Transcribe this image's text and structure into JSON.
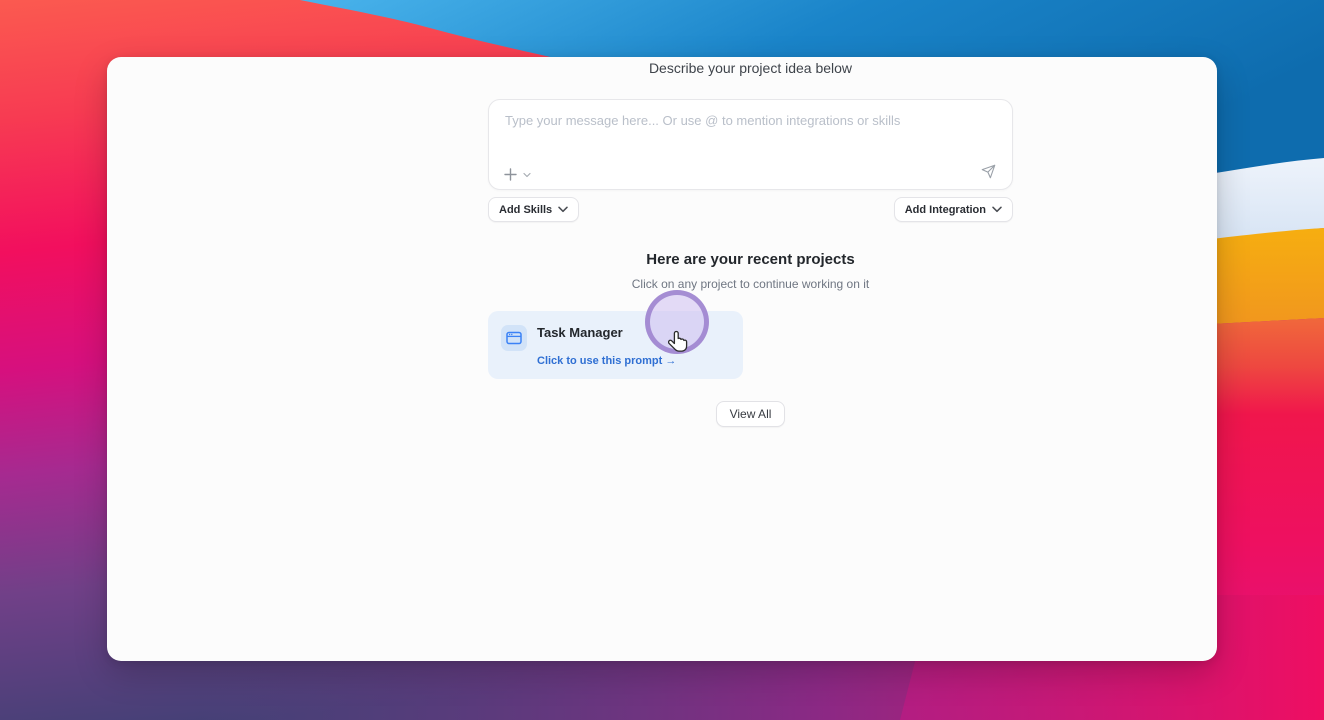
{
  "window": {
    "heading": "Describe your project idea below",
    "composer": {
      "placeholder": "Type your message here... Or use @ to mention integrations or skills",
      "icons": {
        "attach": "plus-icon",
        "attach_expand": "chevron-down-icon",
        "send": "send-icon"
      }
    },
    "actions": {
      "add_skills_label": "Add Skills",
      "add_integration_label": "Add Integration"
    },
    "recent": {
      "title": "Here are your recent projects",
      "subtitle": "Click on any project to continue working on it",
      "projects": [
        {
          "name": "Task Manager",
          "cta": "Click to use this prompt →",
          "icon": "app-window-icon"
        }
      ],
      "view_all_label": "View All"
    }
  },
  "overlay": {
    "cursor": "hand-pointer",
    "click_ring_color": "#9a80cd",
    "click_fill_color": "#cebdf1"
  },
  "colors": {
    "window_bg": "#fcfcfc",
    "card_bg": "#e9f1fb",
    "card_icon_chip_bg": "#d2e3f8",
    "icon_blue": "#3b82f6",
    "link_blue": "#2f6fd3",
    "wallpaper_coral": "#fb5a50",
    "wallpaper_pink": "#f20f5e",
    "wallpaper_indigo": "#454076",
    "wallpaper_blue": "#1a84c9",
    "wallpaper_orange": "#f5a716"
  }
}
